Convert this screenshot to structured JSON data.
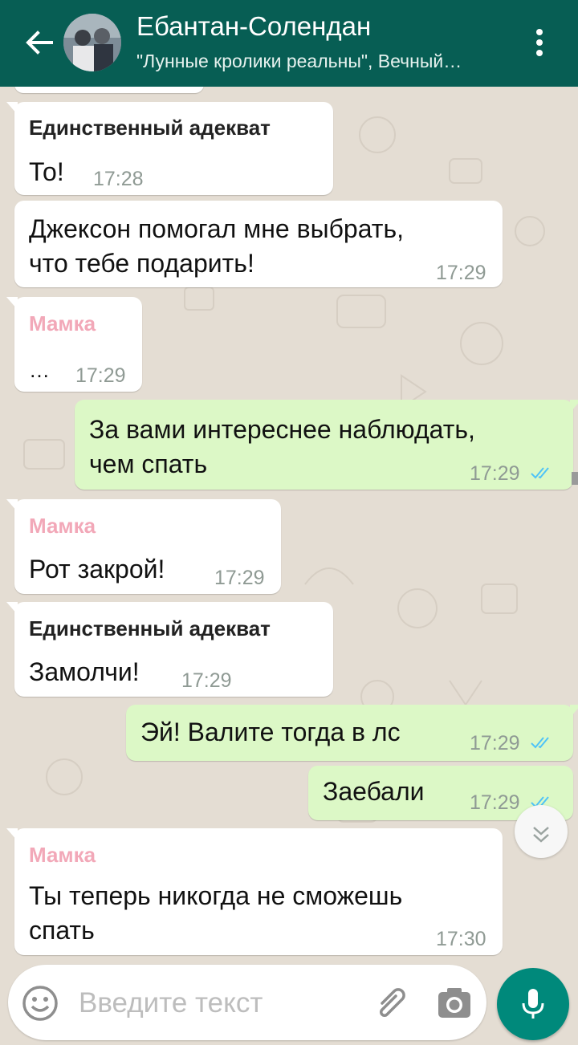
{
  "header": {
    "title": "Ебантан-Солендан",
    "subtitle": "\"Лунные кролики реальны\", Вечный…",
    "colors": {
      "bar": "#075e54",
      "accent": "#00897b"
    },
    "icons": {
      "back": "arrow-back-icon",
      "menu": "more-vertical-icon"
    }
  },
  "messages": [
    {
      "sender": "Единственный адекват",
      "text": "То!",
      "time": "17:28"
    },
    {
      "text_lines": [
        "Джексон помогал мне выбрать,",
        "что тебе подарить!"
      ],
      "time": "17:29"
    },
    {
      "sender": "Мамка",
      "text": "…",
      "time": "17:29"
    },
    {
      "text_lines": [
        "За вами интереснее наблюдать,",
        "чем спать"
      ],
      "time": "17:29",
      "status": "read"
    },
    {
      "sender": "Мамка",
      "text": "Рот закрой!",
      "time": "17:29"
    },
    {
      "sender": "Единственный адекват",
      "text": "Замолчи!",
      "time": "17:29"
    },
    {
      "text": "Эй! Валите тогда в лс",
      "time": "17:29",
      "status": "read"
    },
    {
      "text": "Заебали",
      "time": "17:29",
      "status": "read"
    },
    {
      "sender": "Мамка",
      "text_lines": [
        "Ты теперь никогда не сможешь",
        "спать"
      ],
      "time": "17:30"
    }
  ],
  "composer": {
    "placeholder": "Введите текст",
    "icons": {
      "emoji": "emoji-icon",
      "attach": "paperclip-icon",
      "camera": "camera-icon",
      "mic": "microphone-icon",
      "scroll": "chevron-down-icon"
    }
  },
  "colors": {
    "incoming_bubble": "#ffffff",
    "outgoing_bubble": "#dcf8c6",
    "sender_pink": "#f2a8b8",
    "read_ticks": "#4fc3f7",
    "wallpaper": "#e4ddd3"
  }
}
